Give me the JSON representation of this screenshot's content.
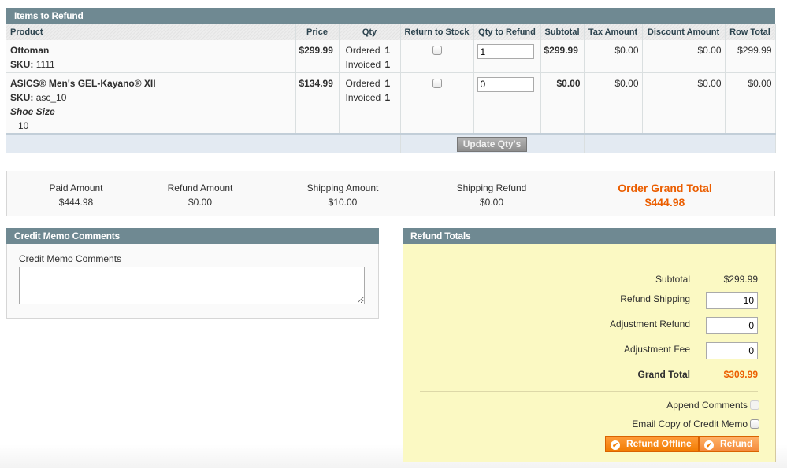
{
  "items_section": {
    "title": "Items to Refund",
    "columns": [
      "Product",
      "Price",
      "Qty",
      "Return to Stock",
      "Qty to Refund",
      "Subtotal",
      "Tax Amount",
      "Discount Amount",
      "Row Total"
    ],
    "rows": [
      {
        "name": "Ottoman",
        "sku_label": "SKU:",
        "sku": "1111",
        "option_label": "",
        "option_value": "",
        "price": "$299.99",
        "ordered_label": "Ordered",
        "ordered": "1",
        "invoiced_label": "Invoiced",
        "invoiced": "1",
        "return_to_stock": false,
        "qty_to_refund": "1",
        "subtotal": "$299.99",
        "tax": "$0.00",
        "discount": "$0.00",
        "row_total": "$299.99"
      },
      {
        "name": "ASICS® Men's GEL-Kayano® XII",
        "sku_label": "SKU:",
        "sku": "asc_10",
        "option_label": "Shoe Size",
        "option_value": "10",
        "price": "$134.99",
        "ordered_label": "Ordered",
        "ordered": "1",
        "invoiced_label": "Invoiced",
        "invoiced": "1",
        "return_to_stock": false,
        "qty_to_refund": "0",
        "subtotal": "$0.00",
        "tax": "$0.00",
        "discount": "$0.00",
        "row_total": "$0.00"
      }
    ],
    "update_button": "Update Qty's"
  },
  "summary": {
    "paid_label": "Paid Amount",
    "paid": "$444.98",
    "refund_label": "Refund Amount",
    "refund": "$0.00",
    "shipping_label": "Shipping Amount",
    "shipping": "$10.00",
    "shipping_refund_label": "Shipping Refund",
    "shipping_refund": "$0.00",
    "grand_label": "Order Grand Total",
    "grand": "$444.98"
  },
  "comments": {
    "title": "Credit Memo Comments",
    "field_label": "Credit Memo Comments",
    "value": ""
  },
  "totals": {
    "title": "Refund Totals",
    "subtotal_label": "Subtotal",
    "subtotal": "$299.99",
    "refund_shipping_label": "Refund Shipping",
    "refund_shipping": "10",
    "adjustment_refund_label": "Adjustment Refund",
    "adjustment_refund": "0",
    "adjustment_fee_label": "Adjustment Fee",
    "adjustment_fee": "0",
    "grand_total_label": "Grand Total",
    "grand_total": "$309.99",
    "append_comments_label": "Append Comments",
    "email_copy_label": "Email Copy of Credit Memo",
    "refund_offline_button": "Refund Offline",
    "refund_button": "Refund"
  },
  "colors": {
    "header_bg": "#6f8992",
    "accent_orange": "#eb5e00",
    "totals_bg": "#fbf9c3",
    "button_orange": "#f17b00"
  }
}
